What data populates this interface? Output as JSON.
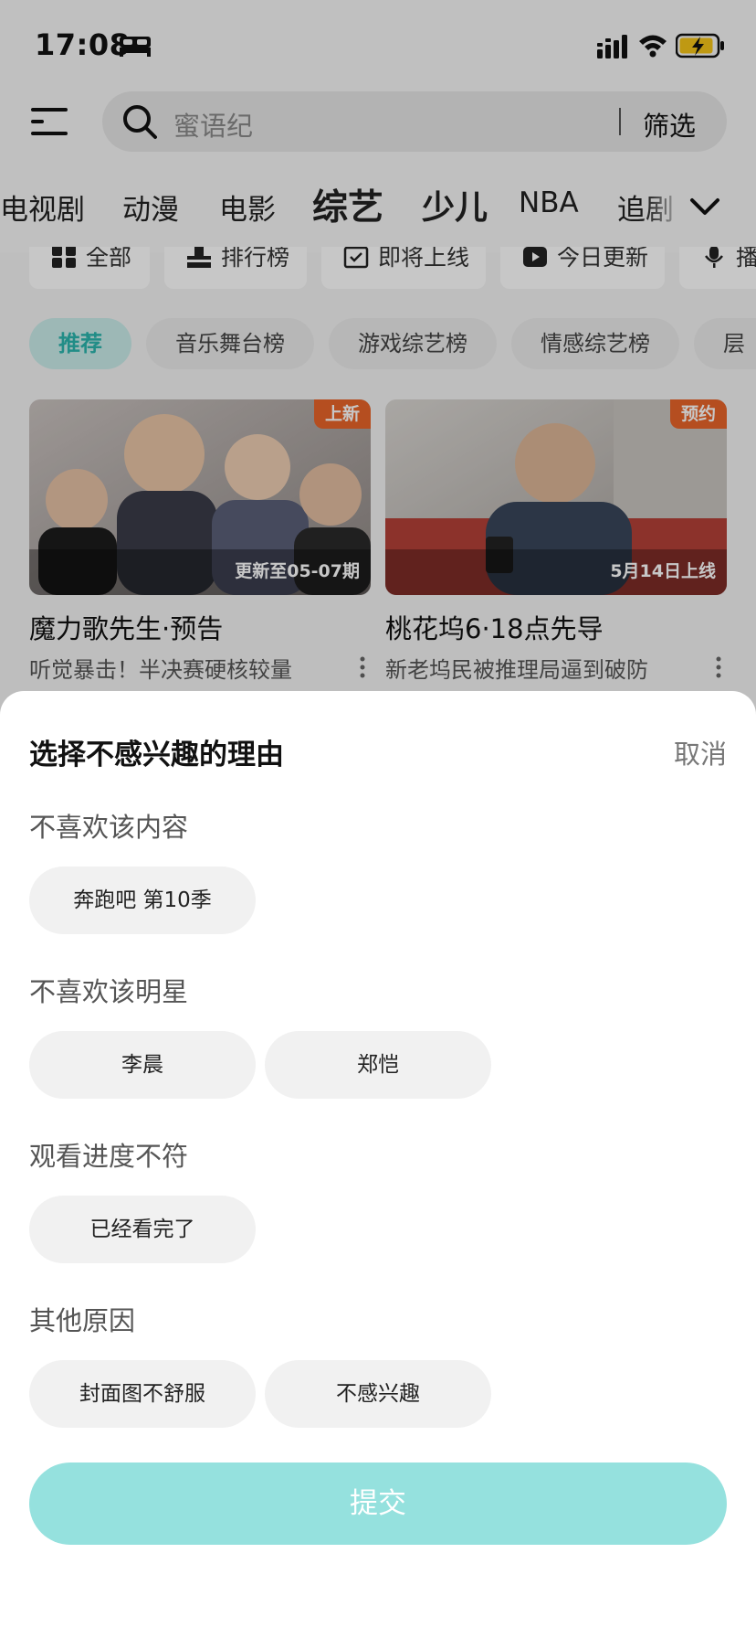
{
  "status_bar": {
    "time": "17:08"
  },
  "header": {
    "search_placeholder": "蜜语纪",
    "filter_label": "筛选",
    "channel_tabs": [
      "电视剧",
      "动漫",
      "电影",
      "综艺",
      "少儿",
      "NBA",
      "追剧"
    ]
  },
  "quick_links": [
    "全部",
    "排行榜",
    "即将上线",
    "今日更新",
    "播"
  ],
  "sub_tabs": [
    "推荐",
    "音乐舞台榜",
    "游戏综艺榜",
    "情感综艺榜",
    "层"
  ],
  "cards": [
    {
      "badge": "上新",
      "caption": "更新至05-07期",
      "title": "魔力歌先生·预告",
      "subtitle": "听觉暴击！半决赛硬核较量"
    },
    {
      "badge": "预约",
      "caption": "5月14日上线",
      "title": "桃花坞6·18点先导",
      "subtitle": "新老坞民被推理局逼到破防"
    }
  ],
  "sheet": {
    "title": "选择不感兴趣的理由",
    "cancel": "取消",
    "sections": [
      {
        "title": "不喜欢该内容",
        "chips": [
          "奔跑吧 第10季"
        ]
      },
      {
        "title": "不喜欢该明星",
        "chips": [
          "李晨",
          "郑恺"
        ]
      },
      {
        "title": "观看进度不符",
        "chips": [
          "已经看完了"
        ]
      },
      {
        "title": "其他原因",
        "chips": [
          "封面图不舒服",
          "不感兴趣"
        ]
      }
    ],
    "submit": "提交"
  },
  "colors": {
    "accent": "#2bb5ad",
    "submit_disabled": "#95e1de",
    "badge": "#e8652a"
  }
}
